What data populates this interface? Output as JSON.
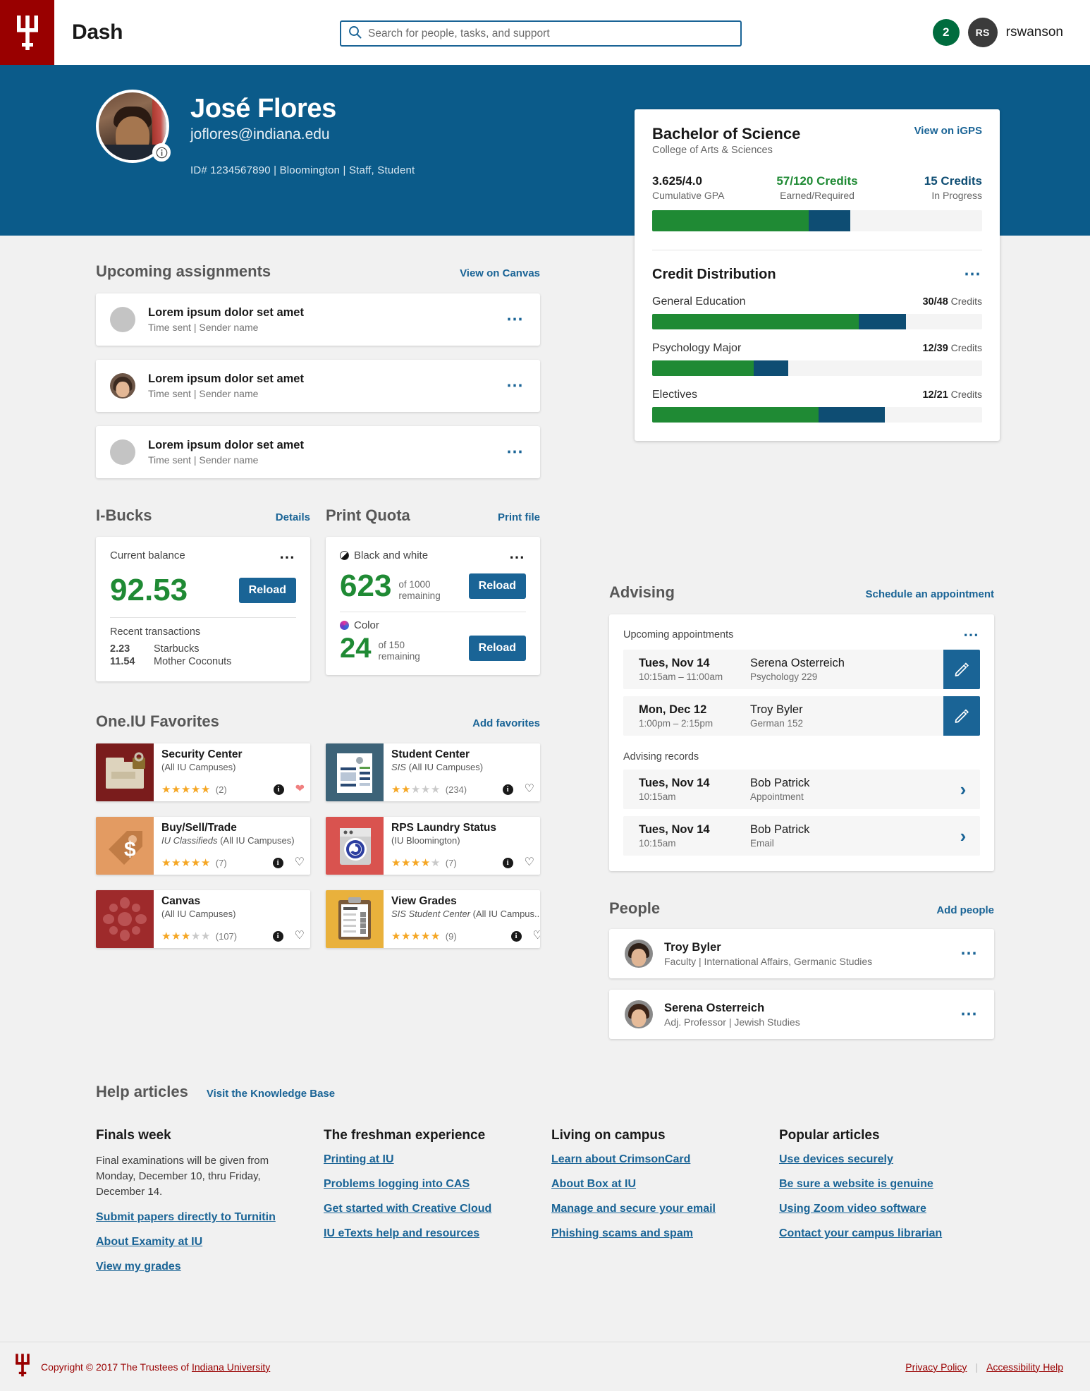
{
  "brand": {
    "title": "Dash",
    "logo_icon": "iu-trident-icon"
  },
  "search": {
    "placeholder": "Search for people, tasks, and support",
    "icon": "search-icon",
    "value": ""
  },
  "nav_right": {
    "notification_count": "2",
    "avatar_initials": "RS",
    "username": "rswanson"
  },
  "profile": {
    "name": "José Flores",
    "email": "joflores@indiana.edu",
    "meta": "ID# 1234567890  |  Bloomington  |  Staff, Student",
    "info_icon": "info-icon"
  },
  "degree": {
    "name": "Bachelor of Science",
    "school": "College of Arts & Sciences",
    "link": "View on iGPS",
    "stats": [
      {
        "value": "3.625/4.0",
        "label": "Cumulative GPA",
        "color": "dark"
      },
      {
        "value": "57/120 Credits",
        "label": "Earned/Required",
        "color": "green"
      },
      {
        "value": "15 Credits",
        "label": "In Progress",
        "color": "navy"
      }
    ],
    "overall_bar": {
      "earned_pct": 47.5,
      "progress_pct": 12.5
    },
    "credit_distribution": {
      "title": "Credit Distribution",
      "menu_icon": "ellipsis-icon",
      "items": [
        {
          "name": "General Education",
          "earned": "30",
          "required": "48",
          "suffix": "Credits",
          "earned_pct": 62.5,
          "progress_pct": 14.5
        },
        {
          "name": "Psychology Major",
          "earned": "12",
          "required": "39",
          "suffix": "Credits",
          "earned_pct": 30.8,
          "progress_pct": 10.5
        },
        {
          "name": "Electives",
          "earned": "12",
          "required": "21",
          "suffix": "Credits",
          "earned_pct": 50.5,
          "progress_pct": 20.0
        }
      ]
    }
  },
  "assignments": {
    "title": "Upcoming assignments",
    "link": "View on Canvas",
    "menu_icon": "ellipsis-icon",
    "items": [
      {
        "title": "Lorem ipsum dolor set amet",
        "sub": "Time sent  |  Sender name",
        "avatar": "placeholder"
      },
      {
        "title": "Lorem ipsum dolor set amet",
        "sub": "Time sent  |  Sender name",
        "avatar": "photo"
      },
      {
        "title": "Lorem ipsum dolor set amet",
        "sub": "Time sent  |  Sender name",
        "avatar": "placeholder"
      }
    ]
  },
  "ibucks": {
    "title": "I-Bucks",
    "link": "Details",
    "balance_label": "Current balance",
    "balance": "92.53",
    "reload_label": "Reload",
    "menu_icon": "ellipsis-icon",
    "transactions_label": "Recent transactions",
    "transactions": [
      {
        "amount": "2.23",
        "name": "Starbucks"
      },
      {
        "amount": "11.54",
        "name": "Mother Coconuts"
      }
    ]
  },
  "print_quota": {
    "title": "Print Quota",
    "link": "Print file",
    "menu_icon": "ellipsis-icon",
    "items": [
      {
        "label": "Black and white",
        "icon": "bw-circle-icon",
        "count": "623",
        "of": "of 1000",
        "remaining": "remaining",
        "reload_label": "Reload"
      },
      {
        "label": "Color",
        "icon": "color-circle-icon",
        "count": "24",
        "of": "of 150",
        "remaining": "remaining",
        "reload_label": "Reload"
      }
    ]
  },
  "favorites": {
    "title": "One.IU Favorites",
    "link": "Add favorites",
    "items": [
      {
        "name": "Security Center",
        "sub_italic": "",
        "sub": "(All IU Campuses)",
        "stars": 5,
        "count": "(2)",
        "icon": "folder-lock-icon",
        "icon_bg": "#7a1c1c",
        "favorited": true
      },
      {
        "name": "Student Center",
        "sub_italic": "SIS",
        "sub": "(All IU Campuses)",
        "stars": 2,
        "count": "(234)",
        "icon": "document-person-icon",
        "icon_bg": "#3d6378",
        "favorited": false
      },
      {
        "name": "Buy/Sell/Trade",
        "sub_italic": "IU Classifieds",
        "sub": "(All IU Campuses)",
        "stars": 4.5,
        "count": "(7)",
        "icon": "price-tag-dollar-icon",
        "icon_bg": "#e39b62",
        "favorited": false
      },
      {
        "name": "RPS Laundry Status",
        "sub_italic": "",
        "sub": "(IU Bloomington)",
        "stars": 4,
        "count": "(7)",
        "icon": "washing-machine-icon",
        "icon_bg": "#d9534f",
        "favorited": false
      },
      {
        "name": "Canvas",
        "sub_italic": "",
        "sub": "(All IU Campuses)",
        "stars": 3,
        "count": "(107)",
        "icon": "canvas-ring-icon",
        "icon_bg": "#9e2a2b",
        "favorited": false
      },
      {
        "name": "View Grades",
        "sub_italic": "SIS Student Center",
        "sub": "(All IU Campus...",
        "stars": 5,
        "count": "(9)",
        "icon": "grade-report-icon",
        "icon_bg": "#e9b13c",
        "favorited": false
      }
    ]
  },
  "advising": {
    "title": "Advising",
    "link": "Schedule an appointment",
    "upcoming_label": "Upcoming appointments",
    "menu_icon": "ellipsis-icon",
    "appointments": [
      {
        "date": "Tues, Nov 14",
        "time": "10:15am – 11:00am",
        "who": "Serena Osterreich",
        "detail": "Psychology 229",
        "action_icon": "pencil-icon"
      },
      {
        "date": "Mon, Dec 12",
        "time": "1:00pm – 2:15pm",
        "who": "Troy Byler",
        "detail": "German 152",
        "action_icon": "pencil-icon"
      }
    ],
    "records_label": "Advising records",
    "records": [
      {
        "date": "Tues, Nov 14",
        "time": "10:15am",
        "who": "Bob Patrick",
        "detail": "Appointment",
        "action_icon": "chevron-right-icon"
      },
      {
        "date": "Tues, Nov 14",
        "time": "10:15am",
        "who": "Bob Patrick",
        "detail": "Email",
        "action_icon": "chevron-right-icon"
      }
    ]
  },
  "people": {
    "title": "People",
    "link": "Add people",
    "menu_icon": "ellipsis-icon",
    "items": [
      {
        "name": "Troy Byler",
        "role": "Faculty | International Affairs, Germanic Studies",
        "skin": "#e0b594",
        "hair": "#2e2018"
      },
      {
        "name": "Serena Osterreich",
        "role": "Adj. Professor | Jewish Studies",
        "skin": "#e6bb99",
        "hair": "#3a2318"
      }
    ]
  },
  "help": {
    "title": "Help articles",
    "kb_link": "Visit the Knowledge Base",
    "columns": [
      {
        "heading": "Finals week",
        "paragraph": "Final examinations will be given from Monday, December 10, thru Friday, December 14.",
        "links": [
          "Submit papers directly to Turnitin",
          "About Examity at IU",
          "View my grades"
        ]
      },
      {
        "heading": "The freshman experience",
        "paragraph": "",
        "links": [
          "Printing at IU",
          "Problems logging into CAS",
          "Get started with Creative Cloud",
          "IU eTexts help and resources"
        ]
      },
      {
        "heading": "Living on campus",
        "paragraph": "",
        "links": [
          "Learn about CrimsonCard",
          "About Box at IU",
          "Manage and secure your email",
          "Phishing scams and spam"
        ]
      },
      {
        "heading": "Popular articles",
        "paragraph": "",
        "links": [
          "Use devices securely",
          "Be sure a website is genuine",
          "Using Zoom video software",
          "Contact your campus librarian"
        ]
      }
    ]
  },
  "footer": {
    "copyright_prefix": "Copyright © 2017 The Trustees of ",
    "copyright_link": "Indiana University",
    "privacy": "Privacy Policy",
    "separator": "|",
    "accessibility": "Accessibility Help",
    "logo_icon": "iu-trident-icon"
  },
  "colors": {
    "iu_crimson": "#990000",
    "link_blue": "#1a6496",
    "green": "#1f8a34",
    "navy": "#0e4d73",
    "hero_blue": "#0b5b8a"
  }
}
